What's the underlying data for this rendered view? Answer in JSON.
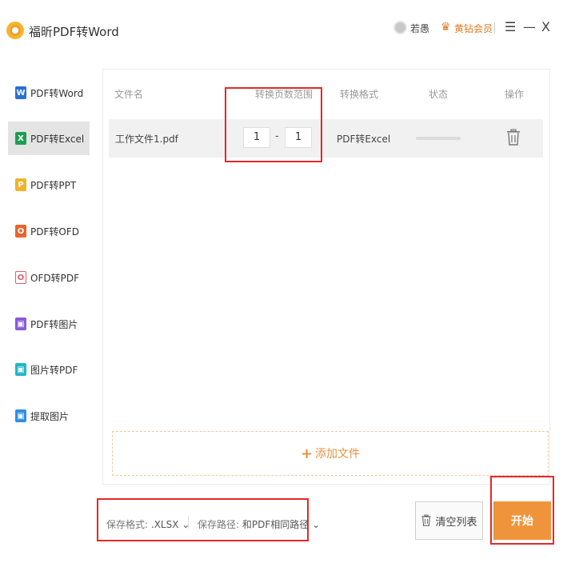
{
  "app": {
    "title": "福昕PDF转Word"
  },
  "titlebar": {
    "username": "若愚",
    "vip_label": "黄钻会员",
    "menu_icon": "☰",
    "minimize_icon": "—",
    "close_icon": "X"
  },
  "sidebar": {
    "items": [
      {
        "label": "PDF转Word",
        "icon": "W",
        "color": "#2b6fd6"
      },
      {
        "label": "PDF转Excel",
        "icon": "X",
        "color": "#1e9d52"
      },
      {
        "label": "PDF转PPT",
        "icon": "P",
        "color": "#f0b429"
      },
      {
        "label": "PDF转OFD",
        "icon": "O",
        "color": "#e8642c"
      },
      {
        "label": "OFD转PDF",
        "icon": "O",
        "color": "#e25b6b"
      },
      {
        "label": "PDF转图片",
        "icon": "▣",
        "color": "#8a5ad8"
      },
      {
        "label": "图片转PDF",
        "icon": "▣",
        "color": "#23b6c8"
      },
      {
        "label": "提取图片",
        "icon": "▣",
        "color": "#2f8fe0"
      }
    ]
  },
  "table": {
    "headers": {
      "filename": "文件名",
      "page_range": "转换页数范围",
      "format": "转换格式",
      "status": "状态",
      "action": "操作"
    },
    "rows": [
      {
        "filename": "工作文件1.pdf",
        "page_from": "1",
        "page_to": "1",
        "format": "PDF转Excel"
      }
    ]
  },
  "add_files": {
    "label": "添加文件"
  },
  "bottom": {
    "save_format_label": "保存格式:",
    "save_format_value": ".XLSX",
    "save_path_label": "保存路径:",
    "save_path_value": "和PDF相同路径",
    "clear_label": "清空列表",
    "start_label": "开始"
  },
  "colors": {
    "accent": "#f0943b",
    "highlight": "#e32929"
  }
}
